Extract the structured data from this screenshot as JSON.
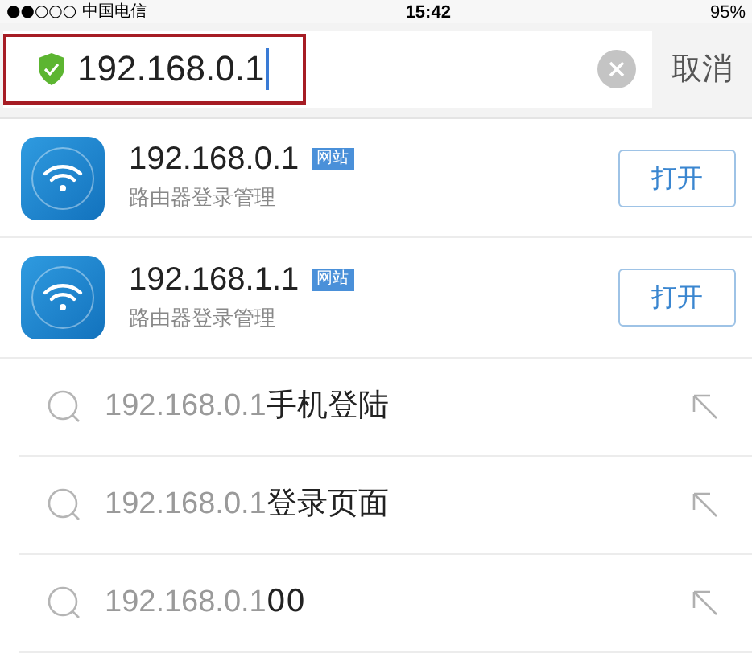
{
  "status_bar": {
    "carrier": "●●○○○ 中国电信",
    "time": "15:42",
    "battery": "95%"
  },
  "search": {
    "value": "192.168.0.1",
    "cancel": "取消"
  },
  "results": [
    {
      "title": "192.168.0.1",
      "tag": "网站",
      "subtitle": "路由器登录管理",
      "button": "打开"
    },
    {
      "title": "192.168.1.1",
      "tag": "网站",
      "subtitle": "路由器登录管理",
      "button": "打开"
    }
  ],
  "suggestions": [
    {
      "match": "192.168.0.1",
      "rest": "手机登陆"
    },
    {
      "match": "192.168.0.1",
      "rest": "登录页面"
    },
    {
      "match": "192.168.0.1",
      "rest": "00"
    }
  ]
}
